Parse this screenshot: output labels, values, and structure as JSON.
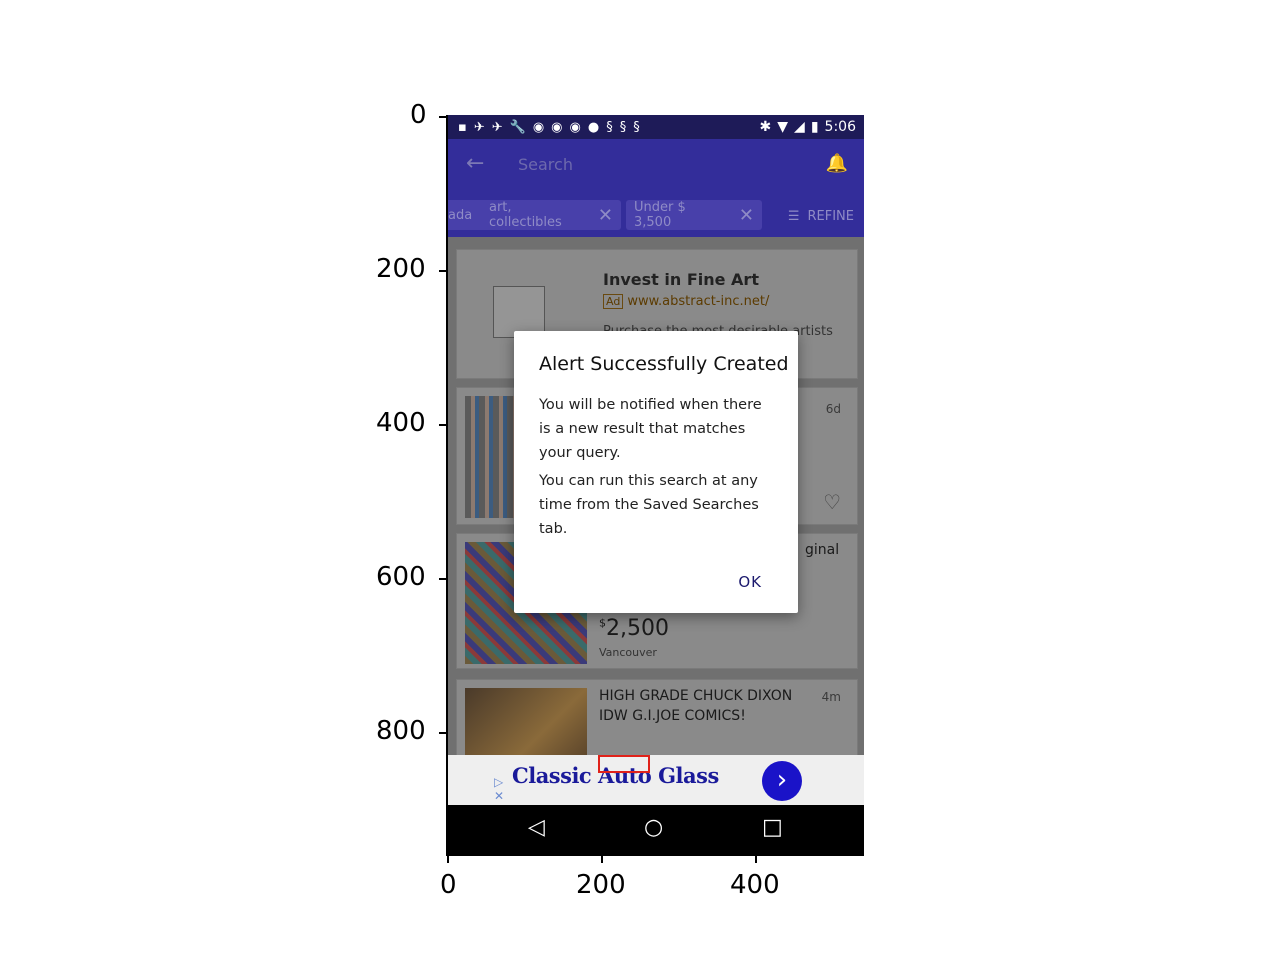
{
  "axes": {
    "y_ticks": [
      "0",
      "200",
      "400",
      "600",
      "800"
    ],
    "x_ticks": [
      "0",
      "200",
      "400"
    ]
  },
  "status_bar": {
    "time": "5:06"
  },
  "app_bar": {
    "search_placeholder": "Search"
  },
  "chips": [
    {
      "label": "ada"
    },
    {
      "label": "art, collectibles"
    },
    {
      "label": "Under $ 3,500"
    }
  ],
  "refine_label": "REFINE",
  "ad_card": {
    "title": "Invest in Fine Art",
    "badge": "Ad",
    "url": "www.abstract-inc.net/",
    "text": "Purchase the most desirable artists ... Max"
  },
  "listings": [
    {
      "age": "6d"
    },
    {
      "title_fragment": "ginal",
      "price": "2,500",
      "currency": "$",
      "location": "Vancouver"
    },
    {
      "title": "HIGH GRADE CHUCK DIXON IDW G.I.JOE COMICS!",
      "age": "4m"
    }
  ],
  "dialog": {
    "title": "Alert Successfully Created",
    "paragraph1": "You will be notified when there is a new result that matches your query.",
    "paragraph2": "You can run this search at any time from the Saved Searches tab.",
    "ok_label": "OK"
  },
  "banner_ad": {
    "text": "Classic Auto Glass"
  },
  "colors": {
    "app_bar": "#332d9a",
    "status_bar": "#1e1b58",
    "ad_text": "#1a1a9a",
    "highlight": "#e0221a"
  }
}
